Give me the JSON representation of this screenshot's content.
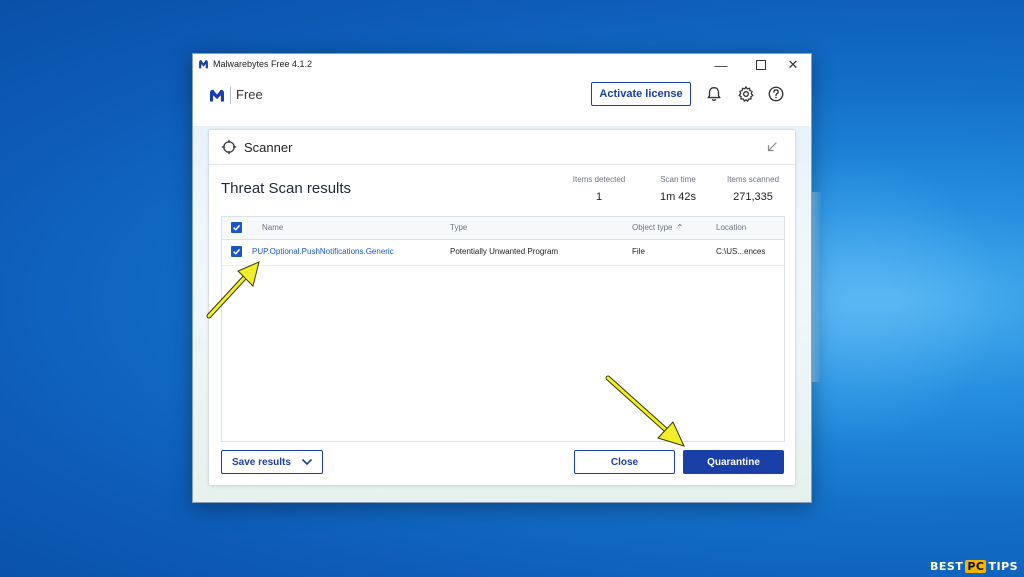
{
  "window": {
    "title": "Malwarebytes Free  4.1.2",
    "accent": "#1a3fa6"
  },
  "header": {
    "tier": "Free",
    "activate_label": "Activate license"
  },
  "scanner": {
    "title": "Scanner",
    "results_title": "Threat Scan results",
    "stats": [
      {
        "label": "Items detected",
        "value": "1"
      },
      {
        "label": "Scan time",
        "value": "1m 42s"
      },
      {
        "label": "Items scanned",
        "value": "271,335"
      }
    ]
  },
  "table": {
    "columns": {
      "name": "Name",
      "type": "Type",
      "object_type": "Object type",
      "location": "Location"
    },
    "rows": [
      {
        "name": "PUP.Optional.PushNotifications.Generic",
        "type": "Potentially Unwanted Program",
        "object_type": "File",
        "location": "C:\\US...ences"
      }
    ]
  },
  "footer": {
    "save_label": "Save results",
    "close_label": "Close",
    "quarantine_label": "Quarantine"
  },
  "watermark": {
    "part1": "BEST",
    "part2": "PC",
    "part3": "TIPS"
  }
}
